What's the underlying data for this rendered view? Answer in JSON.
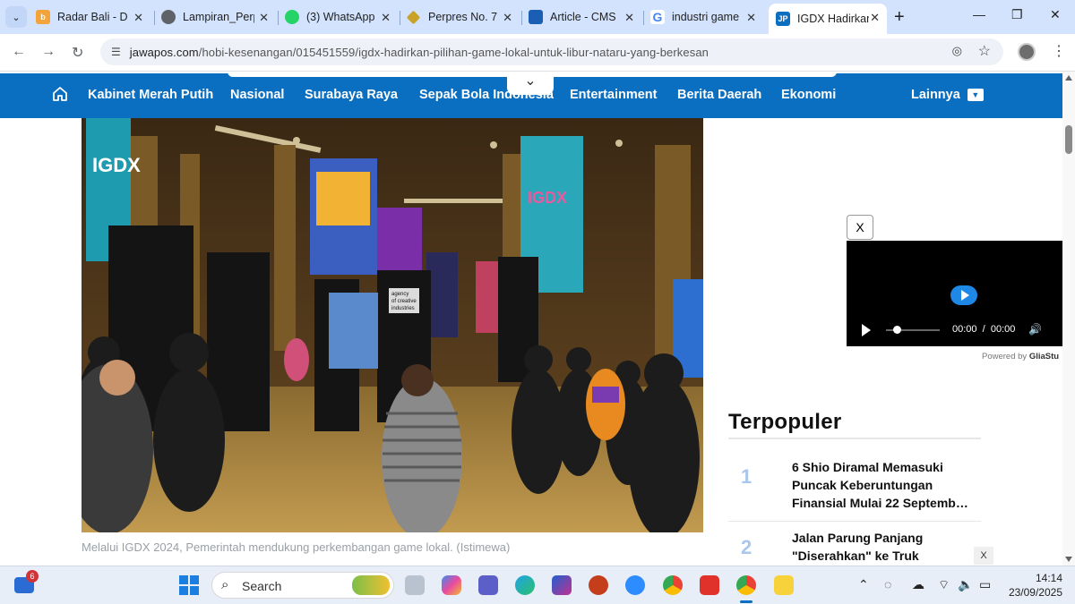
{
  "browser": {
    "tabs": [
      {
        "title": "Radar Bali - D",
        "favicon_color": "#f2a33a",
        "active": false
      },
      {
        "title": "Lampiran_Perp",
        "favicon_color": "#5f6368",
        "active": false
      },
      {
        "title": "(3) WhatsApp",
        "favicon_color": "#25d366",
        "active": false
      },
      {
        "title": "Perpres No. 7",
        "favicon_color": "#c9a227",
        "active": false
      },
      {
        "title": "Article - CMS",
        "favicon_color": "#1a5fb4",
        "active": false
      },
      {
        "title": "industri game",
        "favicon_color": "#4285f4",
        "active": false
      },
      {
        "title": "IGDX Hadirkan",
        "favicon_color": "#0a6ec1",
        "active": true
      }
    ],
    "favicon_letters": {
      "tab7": "JP"
    },
    "url_host": "jawapos.com",
    "url_path": "/hobi-kesenangan/015451559/igdx-hadirkan-pilihan-game-lokal-untuk-libur-nataru-yang-berkesan"
  },
  "site": {
    "nav_items": [
      "Kabinet Merah Putih",
      "Nasional",
      "Surabaya Raya",
      "Sepak Bola Indonesia",
      "Entertainment",
      "Berita Daerah",
      "Ekonomi"
    ],
    "more_label": "Lainnya",
    "accent": "#0a6ec1"
  },
  "article": {
    "photo_caption": "Melalui IGDX 2024, Pemerintah mendukung perkembangan game lokal. (Istimewa)",
    "photo_signage": {
      "booth_logo": "IGDX",
      "booth_text": "agency of creative industries"
    }
  },
  "video": {
    "close_label": "X",
    "time_current": "00:00",
    "time_separator": "/",
    "time_total": "00:00",
    "powered_prefix": "Powered by",
    "powered_brand": "GliaStu"
  },
  "sidebar": {
    "title": "Terpopuler",
    "items": [
      {
        "rank": "1",
        "headline": "6 Shio Diramal Memasuki Puncak Keberuntungan Finansial Mulai 22 Septemb…"
      },
      {
        "rank": "2",
        "headline": "Jalan Parung Panjang \"Diserahkan\" ke Truk"
      }
    ],
    "ad_close": "X"
  },
  "taskbar": {
    "search_label": "Search",
    "weather_badge": "6",
    "time": "14:14",
    "date": "23/09/2025",
    "apps": [
      "start",
      "search",
      "task-view",
      "copilot",
      "teams",
      "edge",
      "m365",
      "powerpoint",
      "zoom",
      "chrome",
      "wps",
      "chrome-profile",
      "sticky-notes"
    ]
  }
}
